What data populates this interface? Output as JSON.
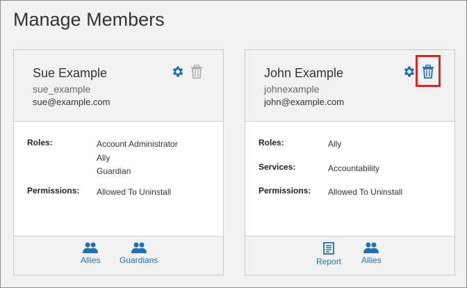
{
  "page": {
    "title": "Manage Members"
  },
  "colors": {
    "accent": "#1f6fb2",
    "highlight": "#e0231c",
    "disabled": "#b0b0b0"
  },
  "members": [
    {
      "name": "Sue Example",
      "username": "sue_example",
      "email": "sue@example.com",
      "icons": [
        "gear-icon",
        "trash-icon"
      ],
      "details": [
        {
          "label": "Roles:",
          "values": [
            "Account Administrator",
            "Ally",
            "Guardian"
          ]
        },
        {
          "label": "Permissions:",
          "values": [
            "Allowed To Uninstall"
          ]
        }
      ],
      "footer_links": [
        {
          "label": "Allies",
          "icon": "people-icon"
        },
        {
          "label": "Guardians",
          "icon": "people-icon"
        }
      ]
    },
    {
      "name": "John Example",
      "username": "johnexample",
      "email": "john@example.com",
      "icons": [
        "gear-icon",
        "trash-icon"
      ],
      "details": [
        {
          "label": "Roles:",
          "values": [
            "Ally"
          ]
        },
        {
          "label": "Services:",
          "values": [
            "Accountability"
          ]
        },
        {
          "label": "Permissions:",
          "values": [
            "Allowed To Uninstall"
          ]
        }
      ],
      "footer_links": [
        {
          "label": "Report",
          "icon": "report-icon"
        },
        {
          "label": "Allies",
          "icon": "people-icon"
        }
      ]
    }
  ]
}
